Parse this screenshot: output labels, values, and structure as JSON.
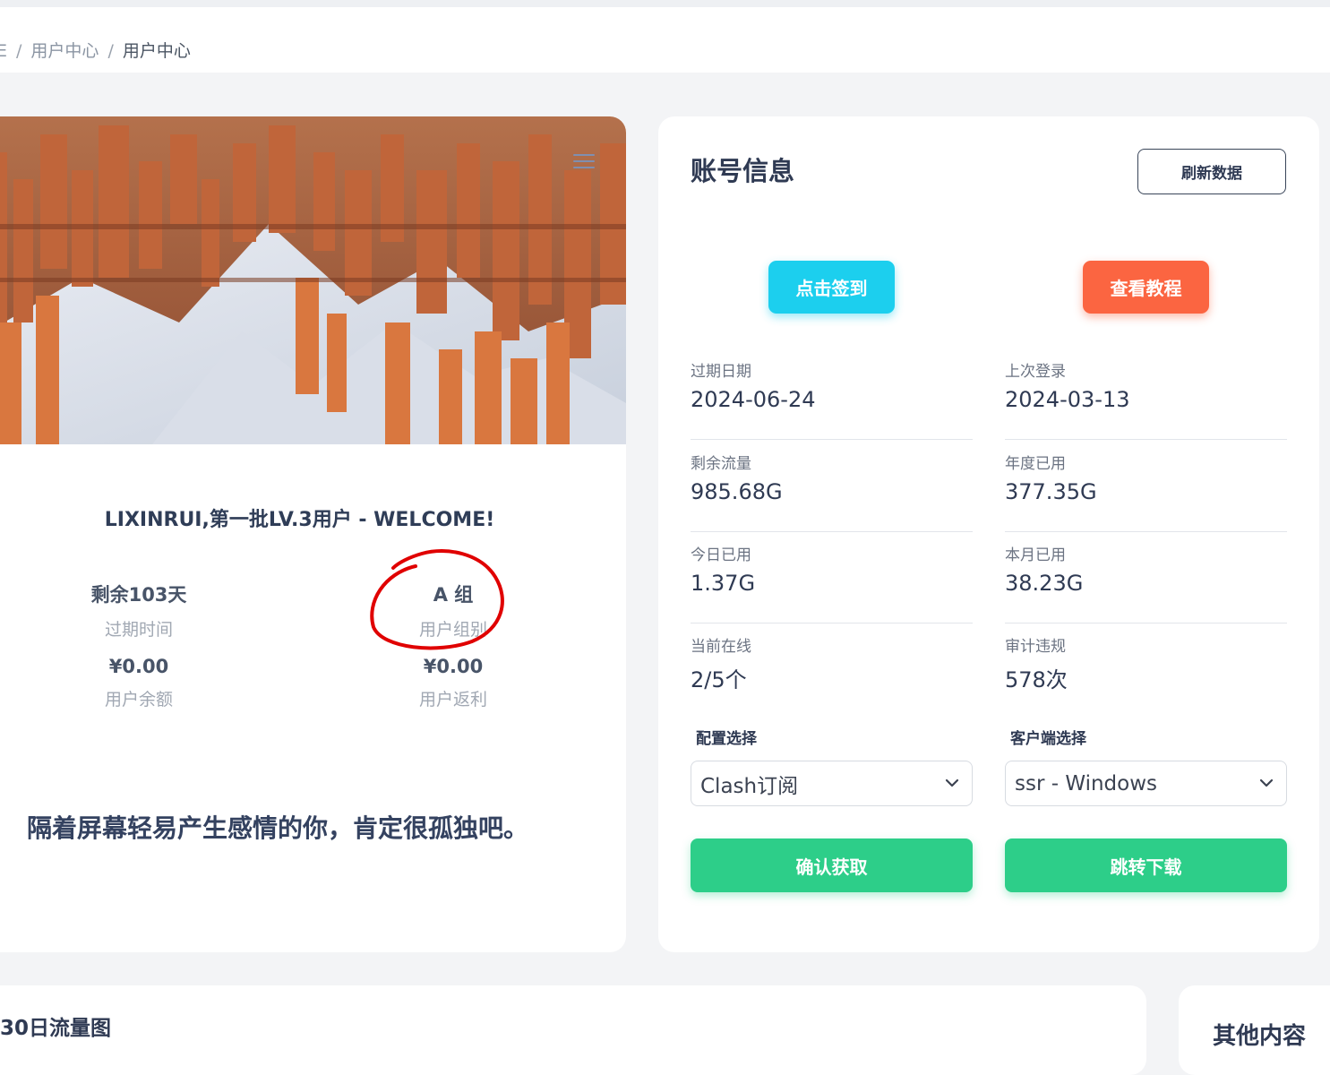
{
  "breadcrumb": {
    "first": "E",
    "items": [
      "用户中心",
      "用户中心"
    ]
  },
  "welcome": "LIXINRUI,第一批LV.3用户 - WELCOME!",
  "stats": {
    "days_value": "剩余103天",
    "days_label": "过期时间",
    "group_value": "A 组",
    "group_label": "用户组别",
    "balance_value": "¥0.00",
    "balance_label": "用户余额",
    "rebate_value": "¥0.00",
    "rebate_label": "用户返利"
  },
  "quote": "隔着屏幕轻易产生感情的你，肯定很孤独吧。",
  "account": {
    "title": "账号信息",
    "refresh_label": "刷新数据",
    "checkin_label": "点击签到",
    "tutorial_label": "查看教程",
    "fields": [
      {
        "label": "过期日期",
        "value": "2024-06-24"
      },
      {
        "label": "上次登录",
        "value": "2024-03-13"
      },
      {
        "label": "剩余流量",
        "value": "985.68G"
      },
      {
        "label": "年度已用",
        "value": "377.35G"
      },
      {
        "label": "今日已用",
        "value": "1.37G"
      },
      {
        "label": "本月已用",
        "value": "38.23G"
      },
      {
        "label": "当前在线",
        "value": "2/5个"
      },
      {
        "label": "审计违规",
        "value": "578次"
      }
    ],
    "config_label": "配置选择",
    "config_value": "Clash订阅",
    "client_label": "客户端选择",
    "client_value": "ssr - Windows",
    "confirm_label": "确认获取",
    "download_label": "跳转下载"
  },
  "bottom": {
    "traffic_title": "30日流量图",
    "other_title": "其他内容"
  },
  "colors": {
    "cyan": "#1ccfee",
    "orange": "#fb6541",
    "green": "#2dce89",
    "annotation": "#e00000"
  }
}
